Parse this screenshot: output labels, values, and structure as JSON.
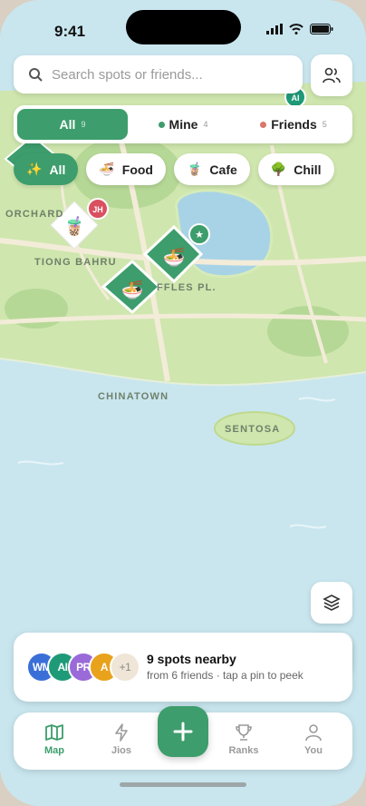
{
  "status_bar": {
    "time": "9:41"
  },
  "search": {
    "placeholder": "Search spots or friends..."
  },
  "segments": [
    {
      "label": "All",
      "count": "9",
      "active": true
    },
    {
      "label": "Mine",
      "count": "4",
      "dot_color": "#3d9d6c"
    },
    {
      "label": "Friends",
      "count": "5",
      "dot_color": "#d9786a"
    }
  ],
  "chips": [
    {
      "label": "All",
      "icon": "sparkles-icon",
      "glyph": "✨",
      "active": true
    },
    {
      "label": "Food",
      "icon": "noodle-bowl-icon",
      "glyph": "🍜"
    },
    {
      "label": "Cafe",
      "icon": "coffee-icon",
      "glyph": "🧋"
    },
    {
      "label": "Chill",
      "icon": "tree-icon",
      "glyph": "🌳"
    }
  ],
  "map": {
    "labels": {
      "orchard": "ORCHARD",
      "tiong_bahru": "TIONG BAHRU",
      "raffles": "FFLES PL.",
      "chinatown": "CHINATOWN",
      "sentosa": "SENTOSA"
    },
    "pins": [
      {
        "badge": "JH",
        "icon": "coffee-icon",
        "glyph": "🧋"
      },
      {
        "icon": "noodle-bowl-icon",
        "glyph": "🍜",
        "badge_icon": "star-icon"
      },
      {
        "icon": "noodle-bowl-icon",
        "glyph": "🍜"
      },
      {
        "badge": "AI"
      }
    ]
  },
  "nearby": {
    "title": "9 spots nearby",
    "subtitle": "from 6 friends · tap a pin to peek",
    "avatars": [
      {
        "initials": "WM",
        "color": "#3b6fd8"
      },
      {
        "initials": "AI",
        "color": "#1f9a78"
      },
      {
        "initials": "PR",
        "color": "#9a6ad8"
      },
      {
        "initials": "A",
        "color": "#e8a21c"
      },
      {
        "initials": "+1",
        "color": "#efe6d8"
      }
    ]
  },
  "tabs": [
    {
      "label": "Map",
      "icon": "map-icon",
      "active": true
    },
    {
      "label": "Jios",
      "icon": "lightning-icon"
    },
    {
      "label": "Ranks",
      "icon": "trophy-icon"
    },
    {
      "label": "You",
      "icon": "person-icon"
    }
  ],
  "colors": {
    "accent": "#3d9d6c",
    "friend": "#d9786a",
    "water": "#c9e6ef",
    "land": "#cde5ad"
  }
}
